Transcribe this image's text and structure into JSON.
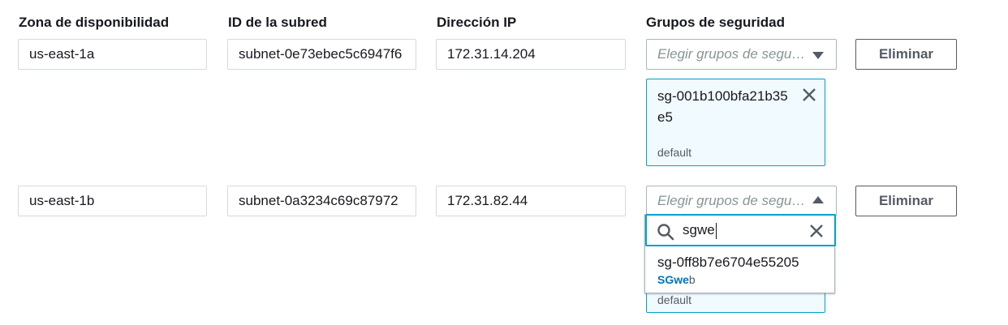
{
  "headers": {
    "zone": "Zona de disponibilidad",
    "subnet": "ID de la subred",
    "ip": "Dirección IP",
    "sg": "Grupos de seguridad"
  },
  "rows": [
    {
      "zone": "us-east-1a",
      "subnet": "subnet-0e73ebec5c6947f6",
      "ip": "172.31.14.204",
      "sg_placeholder": "Elegir grupos de seguridad",
      "remove_label": "Eliminar",
      "selected": [
        {
          "name": "sg-001b100bfa21b35e5",
          "desc": "default"
        }
      ]
    },
    {
      "zone": "us-east-1b",
      "subnet": "subnet-0a3234c69c87972",
      "ip": "172.31.82.44",
      "sg_placeholder": "Elegir grupos de seguridad",
      "remove_label": "Eliminar",
      "selected": [
        {
          "name": "",
          "desc": "default"
        }
      ]
    }
  ],
  "dropdown": {
    "search_value": "sgwe",
    "option": {
      "id": "sg-0ff8b7e6704e55205",
      "tag_match": "SGwe",
      "tag_rest": "b"
    }
  },
  "colors": {
    "accent": "#00a1c9",
    "token_bg": "#f1faff",
    "match_text": "#0073bb"
  }
}
